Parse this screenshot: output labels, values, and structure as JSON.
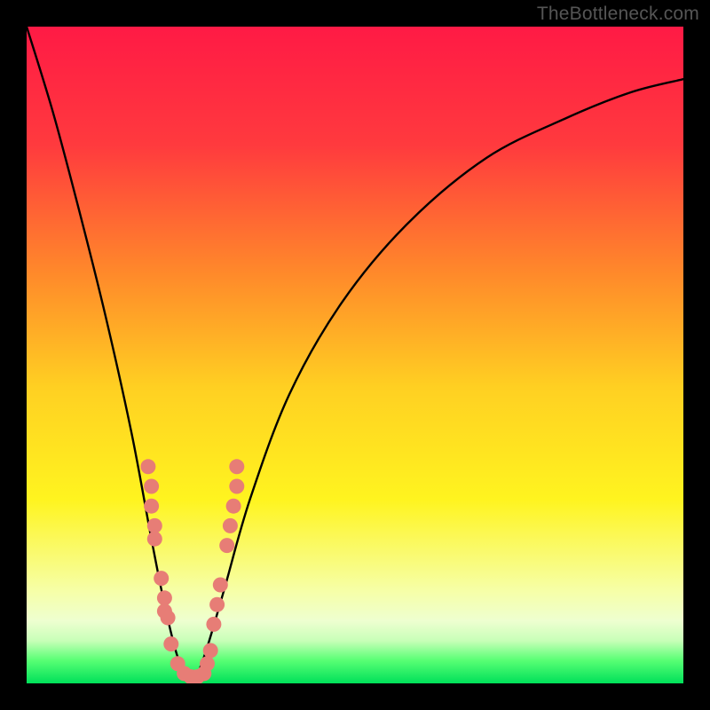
{
  "watermark": "TheBottleneck.com",
  "colors": {
    "frame": "#000000",
    "grad_stops": [
      {
        "o": 0.0,
        "c": "#ff1a45"
      },
      {
        "o": 0.18,
        "c": "#ff3a3e"
      },
      {
        "o": 0.38,
        "c": "#ff8b2a"
      },
      {
        "o": 0.55,
        "c": "#ffd022"
      },
      {
        "o": 0.72,
        "c": "#fff41f"
      },
      {
        "o": 0.86,
        "c": "#f6ffa8"
      },
      {
        "o": 0.905,
        "c": "#eeffd0"
      },
      {
        "o": 0.935,
        "c": "#c8ffb8"
      },
      {
        "o": 0.965,
        "c": "#58ff74"
      },
      {
        "o": 1.0,
        "c": "#00e05a"
      }
    ],
    "curve": "#000000",
    "dot_fill": "#e77d76",
    "dot_stroke": "#c9574f"
  },
  "chart_data": {
    "type": "line",
    "title": "",
    "xlabel": "",
    "ylabel": "",
    "xlim": [
      0,
      100
    ],
    "ylim": [
      0,
      100
    ],
    "series": [
      {
        "name": "bottleneck-curve",
        "comment": "V-shaped curve; y is approximate % height from bottom at given x%",
        "x": [
          0,
          4,
          8,
          12,
          16,
          19,
          21,
          23,
          25,
          27,
          30,
          34,
          40,
          48,
          58,
          70,
          82,
          92,
          100
        ],
        "y": [
          100,
          87,
          72,
          56,
          38,
          22,
          12,
          4,
          0,
          4,
          14,
          28,
          44,
          58,
          70,
          80,
          86,
          90,
          92
        ]
      }
    ],
    "points": {
      "name": "highlight-dots",
      "comment": "salmon dots clustered near the trough of the V",
      "xy": [
        [
          18.5,
          33
        ],
        [
          19.0,
          30
        ],
        [
          19.0,
          27
        ],
        [
          19.5,
          24
        ],
        [
          19.5,
          22
        ],
        [
          20.5,
          16
        ],
        [
          21.0,
          13
        ],
        [
          21.0,
          11
        ],
        [
          21.5,
          10
        ],
        [
          22.0,
          6
        ],
        [
          23.0,
          3
        ],
        [
          24.0,
          1.5
        ],
        [
          25.0,
          1
        ],
        [
          26.0,
          1
        ],
        [
          27.0,
          1.5
        ],
        [
          27.5,
          3
        ],
        [
          28.0,
          5
        ],
        [
          28.5,
          9
        ],
        [
          29.0,
          12
        ],
        [
          29.5,
          15
        ],
        [
          30.5,
          21
        ],
        [
          31.0,
          24
        ],
        [
          31.5,
          27
        ],
        [
          32.0,
          30
        ],
        [
          32.0,
          33
        ]
      ]
    }
  }
}
